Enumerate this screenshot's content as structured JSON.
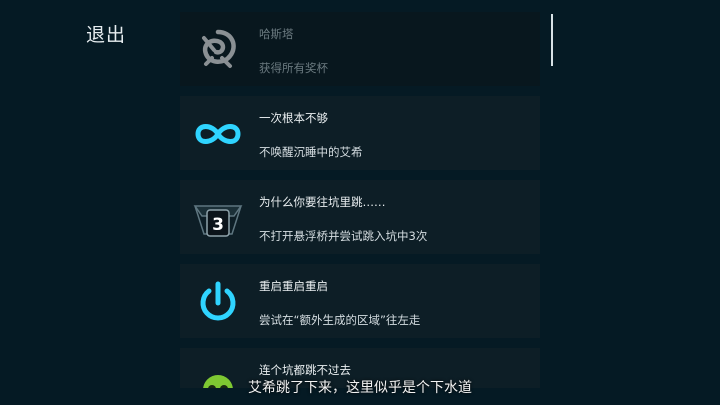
{
  "menu": {
    "exit_label": "退出"
  },
  "achievements": [
    {
      "title": "哈斯塔",
      "description": "获得所有奖杯",
      "icon": "hastur-sigil-icon",
      "unlocked": false
    },
    {
      "title": "一次根本不够",
      "description": "不唤醒沉睡中的艾希",
      "icon": "infinity-icon",
      "unlocked": true
    },
    {
      "title": "为什么你要往坑里跳……",
      "description": "不打开悬浮桥并尝试跳入坑中3次",
      "icon": "pit-three-icon",
      "icon_text": "3",
      "unlocked": true
    },
    {
      "title": "重启重启重启",
      "description": "尝试在“额外生成的区域”往左走",
      "icon": "power-icon",
      "unlocked": true
    },
    {
      "title": "连个坑都跳不过去",
      "description": "",
      "icon": "skull-icon",
      "unlocked": true
    }
  ],
  "subtitle": "艾希跳了下来，这里似乎是个下水道",
  "colors": {
    "background": "#051a24",
    "card": "#0d1e26",
    "accent": "#2fd4ff",
    "skull": "#7ec832"
  }
}
